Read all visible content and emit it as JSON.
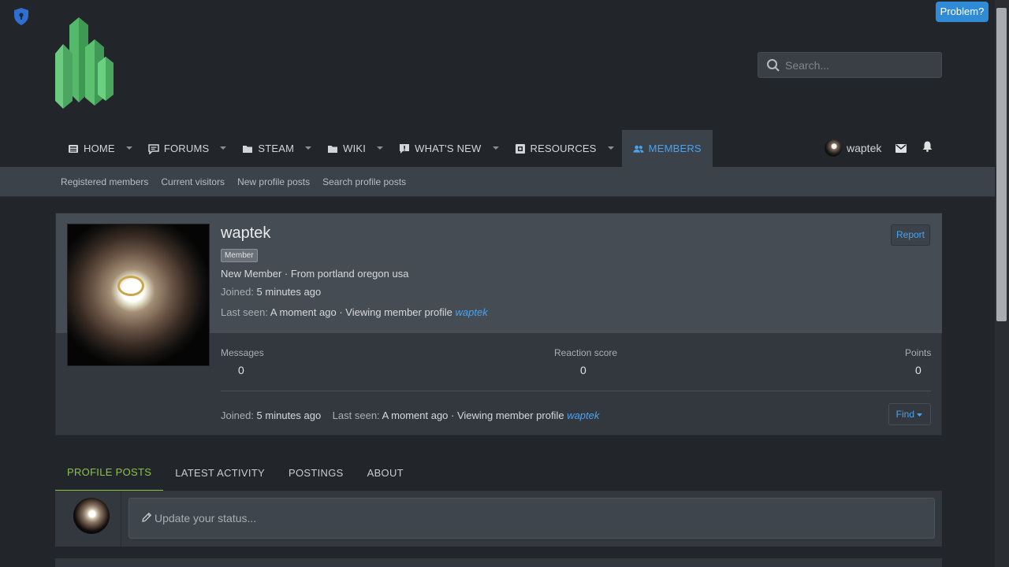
{
  "header": {
    "problem_label": "Problem?",
    "search_placeholder": "Search..."
  },
  "nav": {
    "tabs": [
      {
        "label": "HOME",
        "icon": "newspaper-icon"
      },
      {
        "label": "FORUMS",
        "icon": "comments-icon"
      },
      {
        "label": "STEAM",
        "icon": "folder-icon"
      },
      {
        "label": "WIKI",
        "icon": "folder-icon"
      },
      {
        "label": "WHAT'S NEW",
        "icon": "alert-icon"
      },
      {
        "label": "RESOURCES",
        "icon": "cube-icon"
      },
      {
        "label": "MEMBERS",
        "icon": "users-icon"
      }
    ],
    "active_tab": "MEMBERS",
    "username": "waptek"
  },
  "subnav": {
    "links": [
      "Registered members",
      "Current visitors",
      "New profile posts",
      "Search profile posts"
    ]
  },
  "profile": {
    "name": "waptek",
    "badge": "Member",
    "title": "New Member · From portland oregon usa",
    "joined_label": "Joined:",
    "joined_value": "5 minutes ago",
    "last_seen_label": "Last seen:",
    "last_seen_value": "A moment ago · Viewing member profile",
    "last_seen_link": "waptek",
    "report_label": "Report",
    "stats": [
      {
        "label": "Messages",
        "value": "0"
      },
      {
        "label": "Reaction score",
        "value": "0"
      },
      {
        "label": "Points",
        "value": "0"
      }
    ],
    "find_label": "Find"
  },
  "tabs": {
    "items": [
      "PROFILE POSTS",
      "LATEST ACTIVITY",
      "POSTINGS",
      "ABOUT"
    ],
    "active": "PROFILE POSTS"
  },
  "status": {
    "placeholder": "Update your status..."
  },
  "colors": {
    "accent_blue": "#4aa3ee",
    "accent_green": "#8bc34a",
    "background": "#22262a"
  }
}
